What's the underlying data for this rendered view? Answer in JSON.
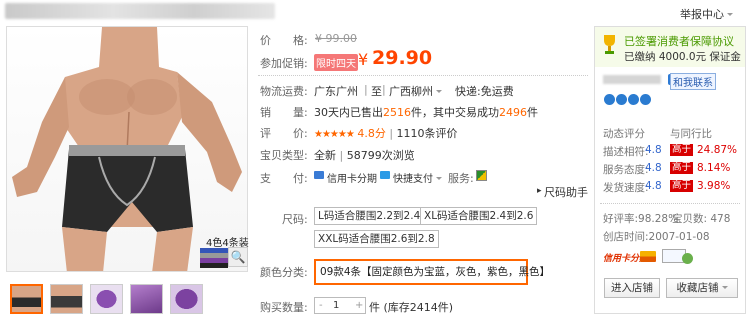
{
  "header": {
    "report_center": "举报中心"
  },
  "gallery": {
    "badge": "4色4条装",
    "zoom_icon": "search-icon",
    "thumbs": 5
  },
  "price": {
    "label": "价　　格:",
    "original": "¥ 99.00",
    "promo_label": "参加促销:",
    "promo_tag": "限时四天",
    "yen": "¥",
    "value": "29.90"
  },
  "shipping": {
    "label": "物流运费:",
    "from": "广东广州",
    "sep": "至",
    "to": "广西柳州",
    "fee": "快递:免运费"
  },
  "sales": {
    "label": "销　　量:",
    "text1": "30天内已售出",
    "sold": "2516",
    "text2": "件，其中交易成功",
    "success": "2496",
    "text3": "件"
  },
  "rating": {
    "label": "评　　价:",
    "stars": "★★★★★",
    "score": "4.8分",
    "sep": "|",
    "count": "1110条评价"
  },
  "item_type": {
    "label": "宝贝类型:",
    "condition": "全新",
    "sep": "|",
    "views": "58799次浏览"
  },
  "payment": {
    "label": "支　　付:",
    "credit": "信用卡分期",
    "quick": "快捷支付",
    "service_label": "服务:",
    "help": "尺码助手"
  },
  "sizes": {
    "label": "尺码:",
    "options": [
      "L码适合腰围2.2到2.4",
      "XL码适合腰围2.4到2.6",
      "XXL码适合腰围2.6到2.8"
    ]
  },
  "color": {
    "label": "颜色分类:",
    "selected": "09款4条【固定颜色为宝蓝，灰色，紫色，黑色】"
  },
  "quantity": {
    "label": "购买数量:",
    "minus": "-",
    "value": "1",
    "plus": "+",
    "stock": "件 (库存2414件)"
  },
  "seller": {
    "guarantee_title": "已签署消费者保障协议",
    "deposit": "已缴纳 4000.0元 保证金",
    "contact": "和我联系",
    "dsr_title": "动态评分",
    "dsr_compare": "与同行比",
    "dsr": [
      {
        "label": "描述相符:",
        "score": "4.8",
        "tag": "高于",
        "pct": "24.87%"
      },
      {
        "label": "服务态度:",
        "score": "4.8",
        "tag": "高于",
        "pct": "8.14%"
      },
      {
        "label": "发货速度:",
        "score": "4.8",
        "tag": "高于",
        "pct": "3.98%"
      }
    ],
    "rate": "好评率:98.28%",
    "items": "宝贝数: 478",
    "created": "创店时间:2007-01-08",
    "credit_text": "信用卡分期",
    "enter_shop": "进入店铺",
    "fav_shop": "收藏店铺"
  },
  "colors": {
    "accent": "#ff4400",
    "green": "#4a9a00"
  }
}
